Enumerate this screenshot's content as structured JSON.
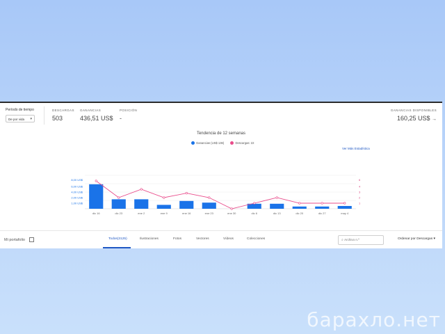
{
  "stats": {
    "period_label": "Período de tiempo",
    "period_value": "De por vida",
    "downloads_label": "DESCARGAS",
    "downloads_value": "503",
    "earnings_label": "GANANCIAS",
    "earnings_value": "436,51 US$",
    "position_label": "POSICIÓN",
    "position_value": "-",
    "available_label": "GANANCIAS DISPONIBLES",
    "available_value": "160,25 US$"
  },
  "chart": {
    "see_stats_link": "Ver Más Estadística",
    "colors": {
      "earnings": "#1a73e8",
      "downloads": "#e94c8b"
    }
  },
  "chart_data": {
    "type": "bar",
    "title": "Tendencia de 12 semanas",
    "categories": [
      "dic 16",
      "dic 23",
      "ene 2",
      "ene 9",
      "ene 16",
      "ene 23",
      "ene 30",
      "dic 6",
      "dic 13",
      "dic 20",
      "dic 27",
      "may 4"
    ],
    "series": [
      {
        "name": "Ganancias (US$ 136)",
        "type": "bar",
        "axis": "left",
        "values": [
          4.4,
          1.7,
          1.7,
          0.7,
          1.4,
          1.1,
          0,
          0.9,
          0.9,
          0.4,
          0.4,
          0.5
        ]
      },
      {
        "name": "Descargas: 22",
        "type": "line",
        "axis": "right",
        "values": [
          5,
          2,
          3.5,
          2,
          2.8,
          2,
          0,
          1,
          2,
          1,
          1,
          1
        ]
      }
    ],
    "ylim": [
      0,
      6
    ],
    "y_ticks": [
      "1,00 US$",
      "2,00 US$",
      "4,00 US$",
      "6,00 US$",
      "8,00 US$"
    ],
    "y2_ticks": [
      "1",
      "2",
      "3",
      "4",
      "6"
    ],
    "grid": true,
    "legend": "top-center"
  },
  "tabsbar": {
    "portfolio": "Mi portafolio",
    "tabs": [
      "Todos(3125)",
      "Ilustraciones",
      "Fotos",
      "Vectores",
      "Vídeos",
      "Colecciones"
    ],
    "search_placeholder": "Archivo n.º",
    "sort_label": "Ordenar por Descargas"
  },
  "watermark": "барахло.нет"
}
